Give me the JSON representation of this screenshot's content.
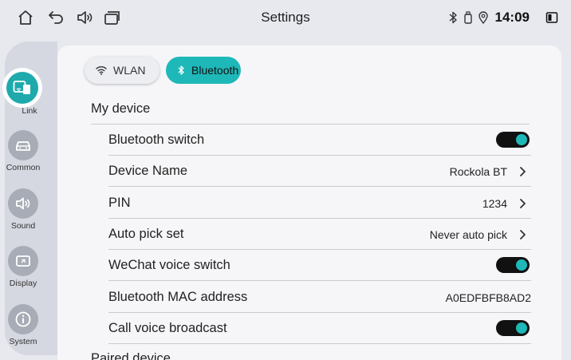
{
  "window": {
    "title": "Settings"
  },
  "status": {
    "time": "14:09"
  },
  "sidebar": {
    "items": [
      {
        "label": "Link",
        "icon": "link-icon",
        "active": true
      },
      {
        "label": "Common",
        "icon": "car-icon"
      },
      {
        "label": "Sound",
        "icon": "speaker-icon"
      },
      {
        "label": "Display",
        "icon": "display-icon"
      },
      {
        "label": "System",
        "icon": "info-icon"
      }
    ]
  },
  "tabs": [
    {
      "label": "WLAN",
      "icon": "wifi-icon",
      "selected": false
    },
    {
      "label": "Bluetooth",
      "icon": "bluetooth-icon",
      "selected": true
    }
  ],
  "my_device": {
    "title": "My device",
    "rows": [
      {
        "label": "Bluetooth switch",
        "toggle": true
      },
      {
        "label": "Device Name",
        "value": "Rockola BT"
      },
      {
        "label": "PIN",
        "value": "1234"
      },
      {
        "label": "Auto pick set",
        "value": "Never auto pick"
      },
      {
        "label": "WeChat voice switch",
        "toggle": true
      },
      {
        "label": "Bluetooth MAC address",
        "value": "A0EDFBFB8AD2"
      },
      {
        "label": "Call voice broadcast",
        "toggle": true
      }
    ]
  },
  "paired": {
    "title": "Paired device"
  },
  "colors": {
    "accent": "#1eb8b8",
    "background": "#e7e9ef",
    "panel": "#f6f6f9"
  }
}
